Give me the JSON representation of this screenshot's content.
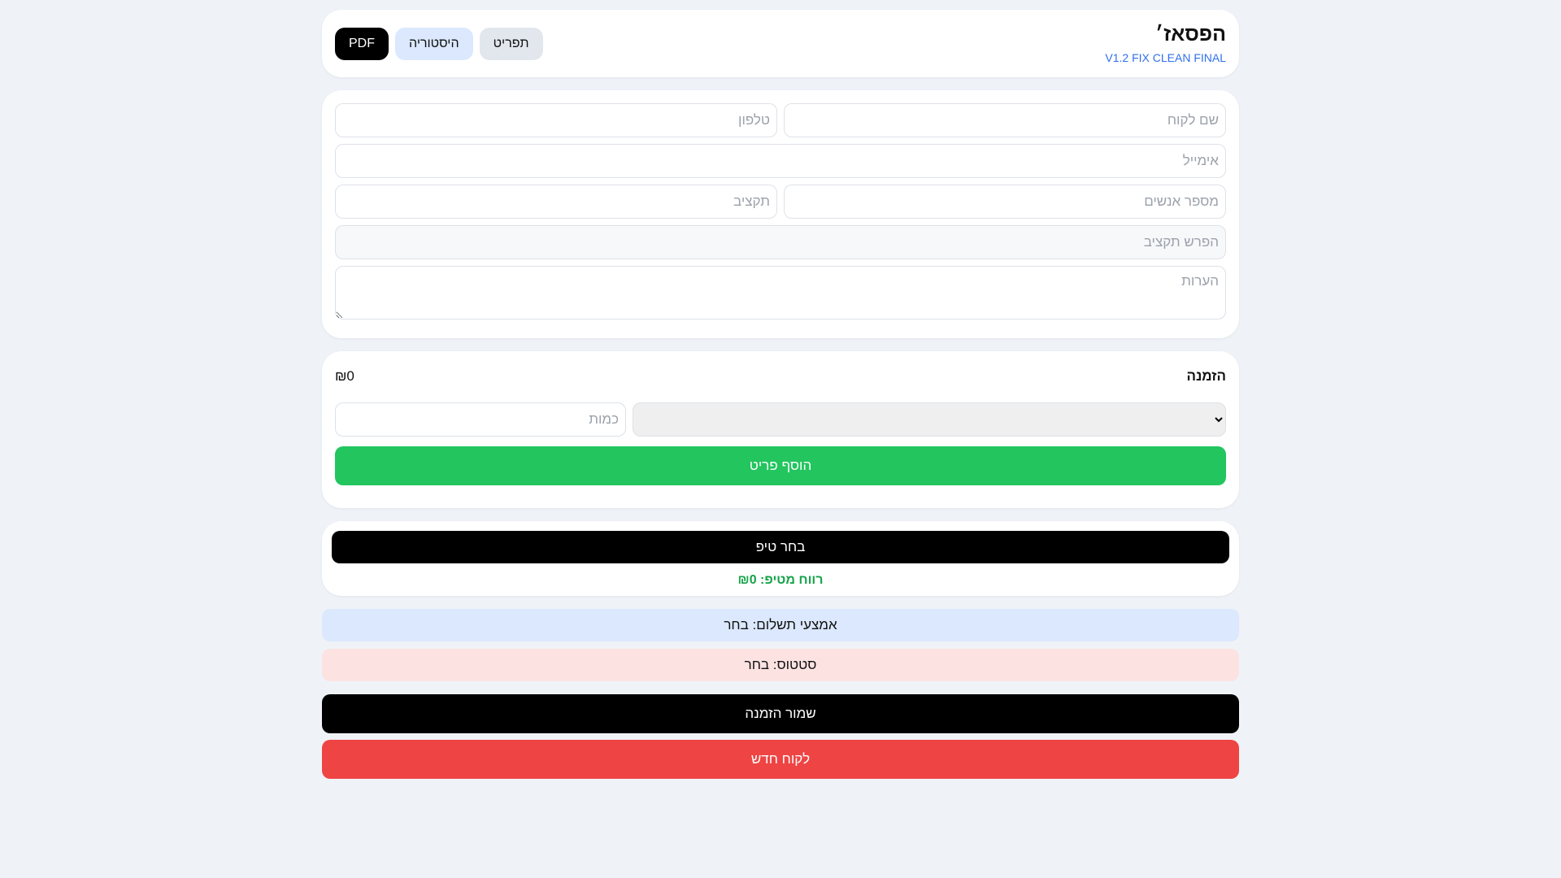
{
  "header": {
    "title": "הפסאז׳",
    "version": "V1.2 FIX CLEAN FINAL",
    "buttons": {
      "menu": "תפריט",
      "history": "היסטוריה",
      "pdf": "PDF"
    }
  },
  "form": {
    "customer_name": "שם לקוח",
    "phone": "טלפון",
    "email": "אימייל",
    "people": "מספר אנשים",
    "budget": "תקציב",
    "budget_diff": "הפרש תקציב",
    "notes": "הערות"
  },
  "order": {
    "title": "הזמנה",
    "total": "₪0",
    "select_value": "",
    "quantity": "כמות",
    "add_item": "הוסף פריט"
  },
  "tip": {
    "choose": "בחר טיפ",
    "profit": "רווח מטיפ: ₪0"
  },
  "payment": "אמצעי תשלום: בחר",
  "status": "סטטוס: בחר",
  "actions": {
    "save": "שמור הזמנה",
    "new_customer": "לקוח חדש"
  }
}
